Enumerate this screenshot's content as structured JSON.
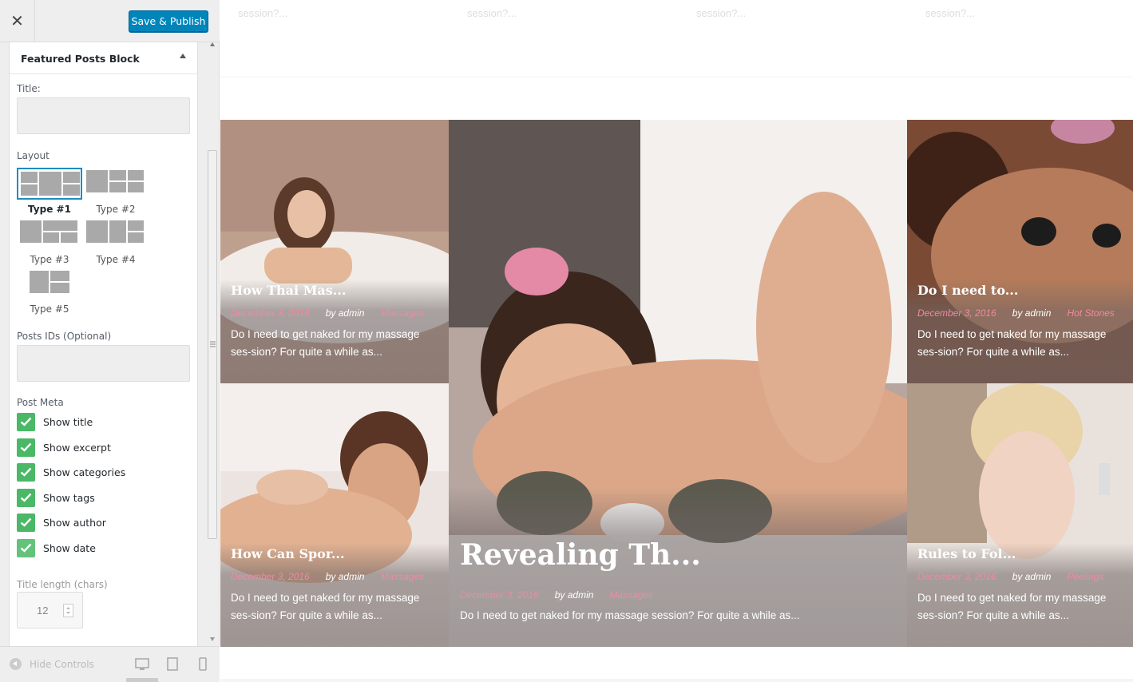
{
  "sidebar": {
    "close_icon": "close-icon",
    "save_button": "Save & Publish",
    "panel_title": "Featured Posts Block",
    "title_label": "Title:",
    "title_value": "",
    "layout_label": "Layout",
    "layouts": [
      {
        "label": "Type #1",
        "selected": true
      },
      {
        "label": "Type #2",
        "selected": false
      },
      {
        "label": "Type #3",
        "selected": false
      },
      {
        "label": "Type #4",
        "selected": false
      },
      {
        "label": "Type #5",
        "selected": false
      }
    ],
    "post_ids_label": "Posts IDs (Optional)",
    "post_ids_value": "",
    "post_meta_label": "Post Meta",
    "post_meta": [
      {
        "label": "Show title",
        "checked": true
      },
      {
        "label": "Show excerpt",
        "checked": true
      },
      {
        "label": "Show categories",
        "checked": true
      },
      {
        "label": "Show tags",
        "checked": true
      },
      {
        "label": "Show author",
        "checked": true
      },
      {
        "label": "Show date",
        "checked": true
      }
    ],
    "title_length_label": "Title length (chars)",
    "title_length_value": "12",
    "hide_controls": "Hide Controls"
  },
  "preview": {
    "top_texts": [
      "session?...",
      "session?...",
      "session?...",
      "session?..."
    ],
    "cards": [
      {
        "title": "How Thai Mas...",
        "date": "December 3, 2016",
        "author": "by admin",
        "category": "Massages",
        "excerpt": "Do I need to get naked for my massage ses-sion? For quite a while as..."
      },
      {
        "title": "Revealing Th...",
        "date": "December 3, 2016",
        "author": "by admin",
        "category": "Massages",
        "excerpt": "Do I need to get naked for my massage session? For quite a while as..."
      },
      {
        "title": "Do I need to...",
        "date": "December 3, 2016",
        "author": "by admin",
        "category": "Hot Stones",
        "excerpt": "Do I need to get naked for my massage ses-sion? For quite a while as..."
      },
      {
        "title": "How Can Spor...",
        "date": "December 3, 2016",
        "author": "by admin",
        "category": "Massages",
        "excerpt": "Do I need to get naked for my massage ses-sion? For quite a while as..."
      },
      {
        "title": "Rules to Fol...",
        "date": "December 3, 2016",
        "author": "by admin",
        "category": "Peelings",
        "excerpt": "Do I need to get naked for my massage ses-sion? For quite a while as..."
      }
    ]
  },
  "colors": {
    "accent": "#0085ba",
    "check_green": "#4ab866",
    "meta_pink": "#f08aa0"
  }
}
